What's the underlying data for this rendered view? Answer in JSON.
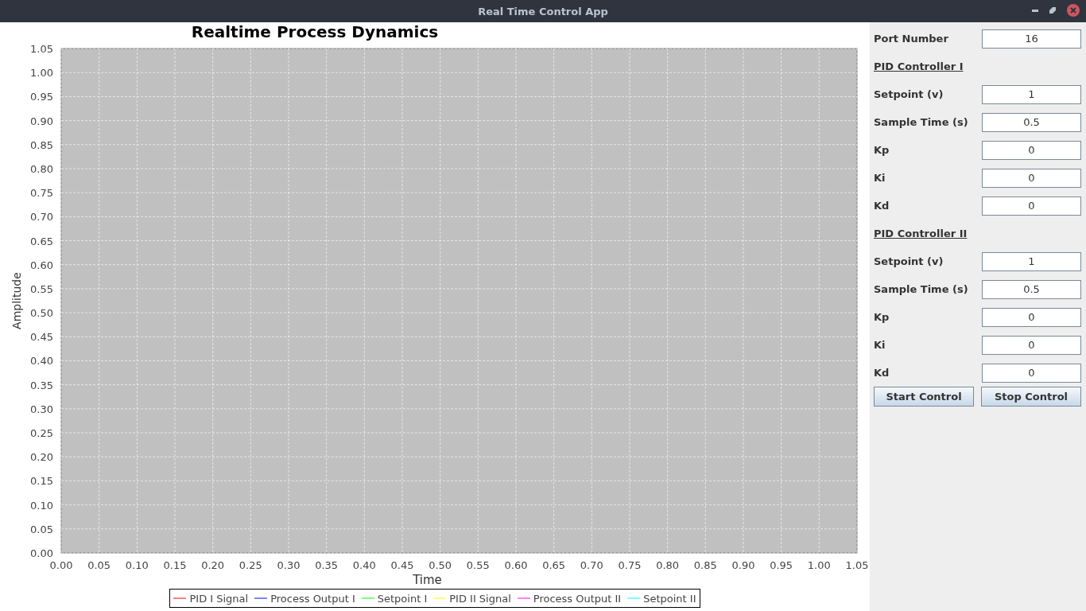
{
  "window": {
    "title": "Real Time Control App"
  },
  "chart": {
    "chart_data": {
      "type": "line",
      "title": "Realtime Process Dynamics",
      "xlabel": "Time",
      "ylabel": "Amplitude",
      "grid": true,
      "ylim": [
        0,
        1.05
      ],
      "categories": [
        "0.00",
        "0.05",
        "0.10",
        "0.15",
        "0.20",
        "0.25",
        "0.30",
        "0.35",
        "0.40",
        "0.45",
        "0.50",
        "0.55",
        "0.60",
        "0.65",
        "0.70",
        "0.75",
        "0.80",
        "0.85",
        "0.90",
        "0.95",
        "1.00",
        "1.05"
      ],
      "yticks": [
        {
          "value": 0,
          "label": "0.00"
        },
        {
          "value": 0.05,
          "label": "0.05"
        },
        {
          "value": 0.1,
          "label": "0.10"
        },
        {
          "value": 0.15,
          "label": "0.15"
        },
        {
          "value": 0.2,
          "label": "0.20"
        },
        {
          "value": 0.25,
          "label": "0.25"
        },
        {
          "value": 0.3,
          "label": "0.30"
        },
        {
          "value": 0.35,
          "label": "0.35"
        },
        {
          "value": 0.4,
          "label": "0.40"
        },
        {
          "value": 0.45,
          "label": "0.45"
        },
        {
          "value": 0.5,
          "label": "0.50"
        },
        {
          "value": 0.55,
          "label": "0.55"
        },
        {
          "value": 0.6,
          "label": "0.60"
        },
        {
          "value": 0.65,
          "label": "0.65"
        },
        {
          "value": 0.7,
          "label": "0.70"
        },
        {
          "value": 0.75,
          "label": "0.75"
        },
        {
          "value": 0.8,
          "label": "0.80"
        },
        {
          "value": 0.85,
          "label": "0.85"
        },
        {
          "value": 0.9,
          "label": "0.90"
        },
        {
          "value": 0.95,
          "label": "0.95"
        },
        {
          "value": 1.0,
          "label": "1.00"
        },
        {
          "value": 1.05,
          "label": "1.05"
        }
      ],
      "series": [
        {
          "name": "PID I Signal",
          "color": "#ff8080",
          "values": [
            null,
            null,
            null,
            null,
            null,
            null,
            null,
            null,
            null,
            null,
            null,
            null,
            null,
            null,
            null,
            null,
            null,
            null,
            null,
            null,
            null,
            null
          ]
        },
        {
          "name": "Process Output I",
          "color": "#8080ff",
          "values": [
            null,
            null,
            null,
            null,
            null,
            null,
            null,
            null,
            null,
            null,
            null,
            null,
            null,
            null,
            null,
            null,
            null,
            null,
            null,
            null,
            null,
            null
          ]
        },
        {
          "name": "Setpoint I",
          "color": "#80ff80",
          "values": [
            null,
            null,
            null,
            null,
            null,
            null,
            null,
            null,
            null,
            null,
            null,
            null,
            null,
            null,
            null,
            null,
            null,
            null,
            null,
            null,
            null,
            null
          ]
        },
        {
          "name": "PID II Signal",
          "color": "#ffff80",
          "values": [
            null,
            null,
            null,
            null,
            null,
            null,
            null,
            null,
            null,
            null,
            null,
            null,
            null,
            null,
            null,
            null,
            null,
            null,
            null,
            null,
            null,
            null
          ]
        },
        {
          "name": "Process Output II",
          "color": "#ff80ff",
          "values": [
            null,
            null,
            null,
            null,
            null,
            null,
            null,
            null,
            null,
            null,
            null,
            null,
            null,
            null,
            null,
            null,
            null,
            null,
            null,
            null,
            null,
            null
          ]
        },
        {
          "name": "Setpoint II",
          "color": "#80ffff",
          "values": [
            null,
            null,
            null,
            null,
            null,
            null,
            null,
            null,
            null,
            null,
            null,
            null,
            null,
            null,
            null,
            null,
            null,
            null,
            null,
            null,
            null,
            null
          ]
        }
      ]
    }
  },
  "panel": {
    "port": {
      "label": "Port Number",
      "value": "16"
    },
    "sections": [
      {
        "heading": "PID Controller I",
        "fields": [
          {
            "label": "Setpoint (v)",
            "value": "1"
          },
          {
            "label": "Sample Time (s)",
            "value": "0.5"
          },
          {
            "label": "Kp",
            "value": "0"
          },
          {
            "label": "Ki",
            "value": "0"
          },
          {
            "label": "Kd",
            "value": "0"
          }
        ]
      },
      {
        "heading": "PID Controller II",
        "fields": [
          {
            "label": "Setpoint (v)",
            "value": "1"
          },
          {
            "label": "Sample Time (s)",
            "value": "0.5"
          },
          {
            "label": "Kp",
            "value": "0"
          },
          {
            "label": "Ki",
            "value": "0"
          },
          {
            "label": "Kd",
            "value": "0"
          }
        ]
      }
    ],
    "buttons": [
      "Start Control",
      "Stop Control"
    ]
  }
}
